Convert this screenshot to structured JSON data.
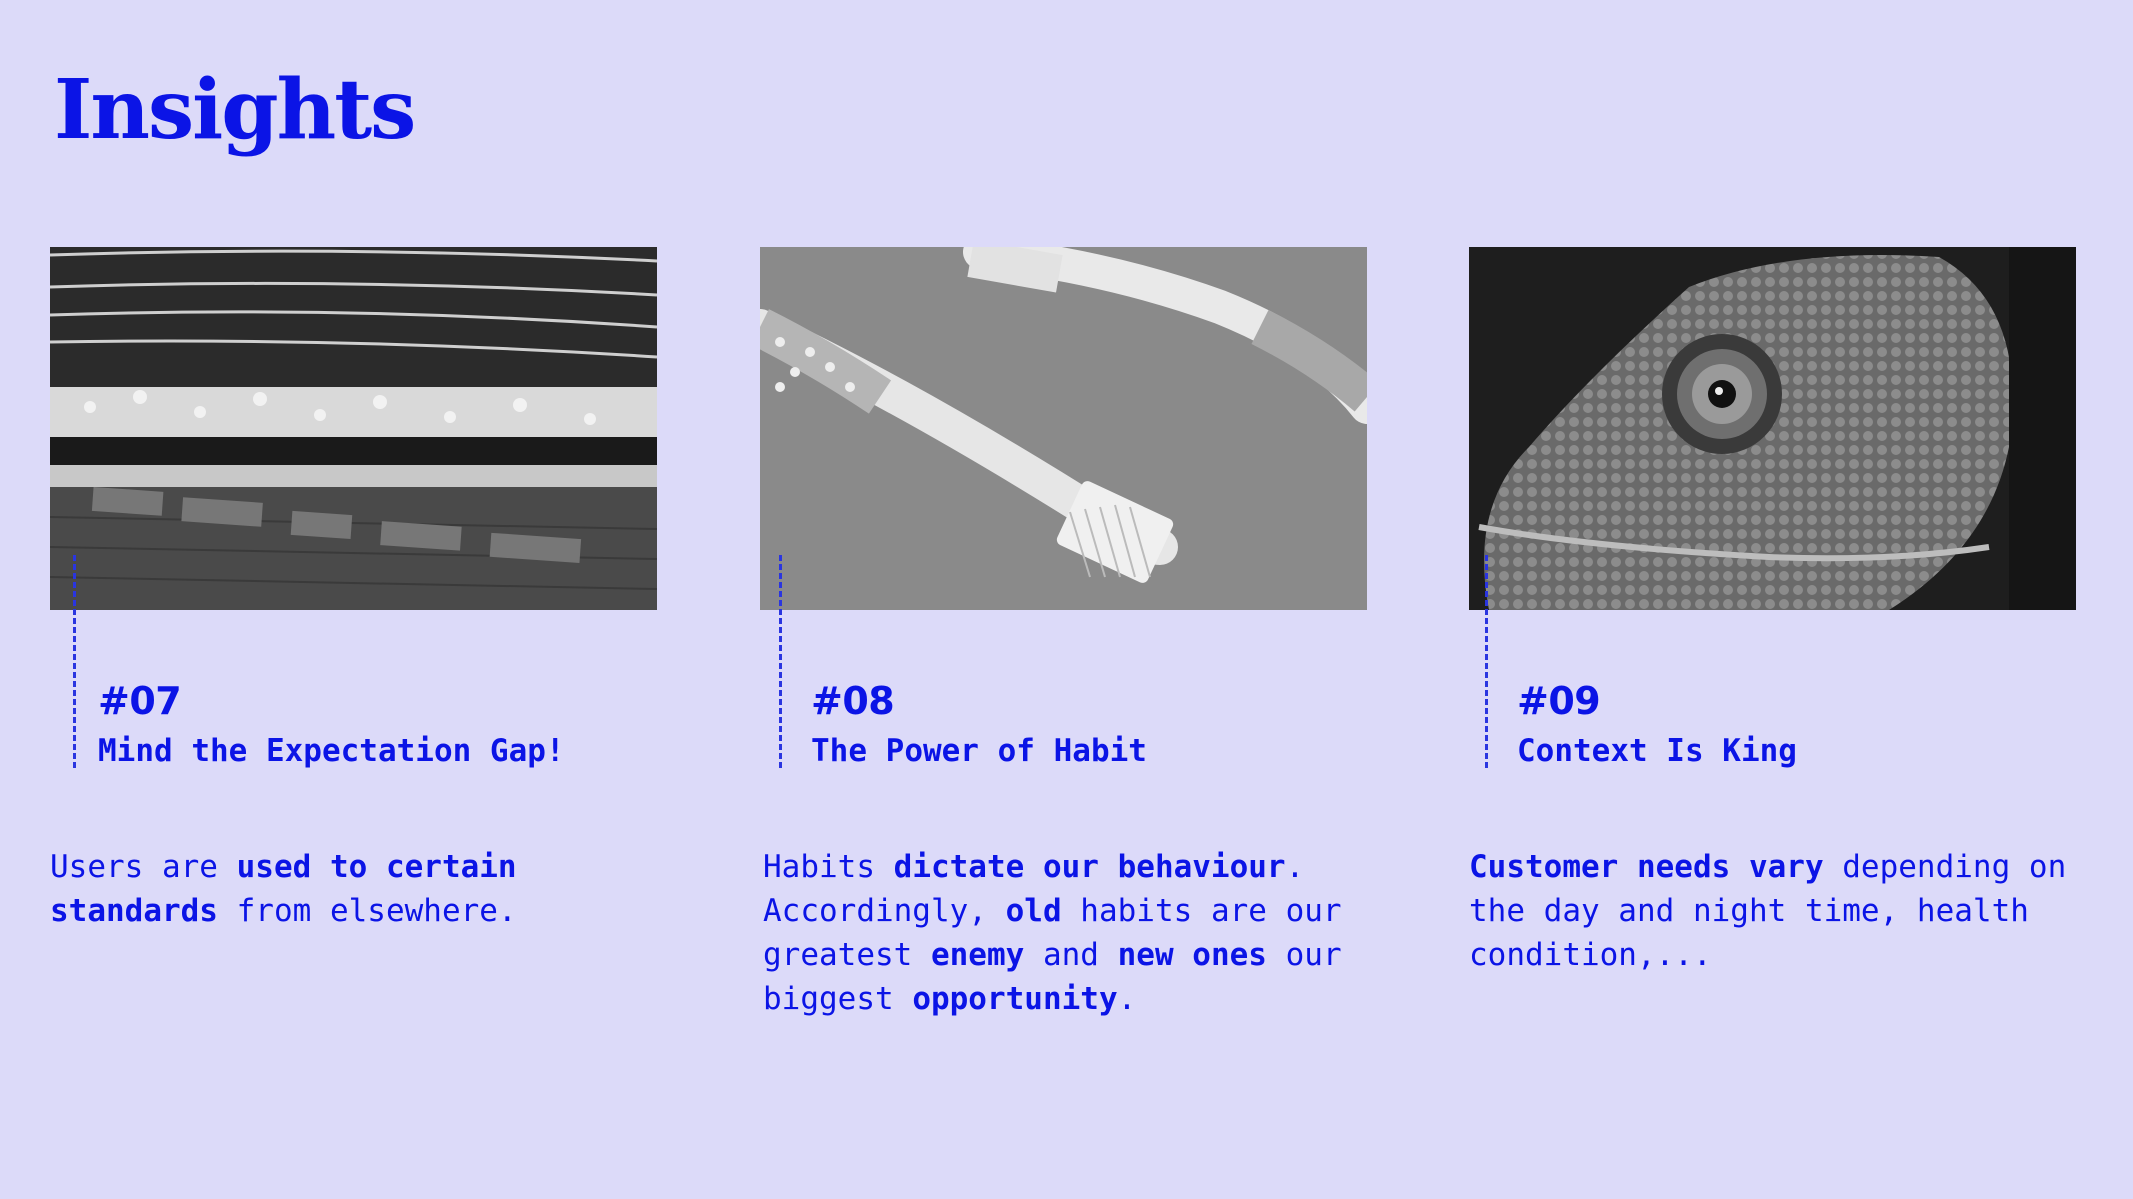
{
  "page": {
    "title": "Insights"
  },
  "colors": {
    "background": "#dcdaf9",
    "accent": "#0b14e6"
  },
  "cards": [
    {
      "number": "#07",
      "heading": "Mind the Expectation Gap!",
      "image": "subway-platform-mind-the-gap-photo",
      "body": [
        {
          "t": "Users are ",
          "b": false
        },
        {
          "t": "used to certain standards",
          "b": true
        },
        {
          "t": " from elsewhere.",
          "b": false
        }
      ]
    },
    {
      "number": "#08",
      "heading": "The Power of Habit",
      "image": "toothbrushes-photo",
      "body": [
        {
          "t": "Habits ",
          "b": false
        },
        {
          "t": "dictate our behaviour",
          "b": true
        },
        {
          "t": ". Accordingly, ",
          "b": false
        },
        {
          "t": "old",
          "b": true
        },
        {
          "t": " habits are our greatest ",
          "b": false
        },
        {
          "t": "enemy",
          "b": true
        },
        {
          "t": " and ",
          "b": false
        },
        {
          "t": "new ones",
          "b": true
        },
        {
          "t": " our biggest ",
          "b": false
        },
        {
          "t": "opportunity",
          "b": true
        },
        {
          "t": ".",
          "b": false
        }
      ]
    },
    {
      "number": "#09",
      "heading": "Context Is King",
      "image": "chameleon-photo",
      "body": [
        {
          "t": "Customer needs vary",
          "b": true
        },
        {
          "t": " depending on the day and night time, health condition,...",
          "b": false
        }
      ]
    }
  ]
}
